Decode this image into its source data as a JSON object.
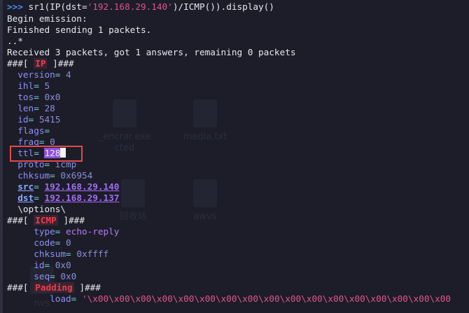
{
  "command": {
    "prompt": ">>>",
    "pre": " sr1(IP(dst=",
    "dst": "'192.168.29.140'",
    "post": ")/ICMP()).display()"
  },
  "output": [
    "Begin emission:",
    "Finished sending 1 packets.",
    "..*",
    "Received 3 packets, got 1 answers, remaining 0 packets"
  ],
  "ip_layer": {
    "header_prefix": "###[ ",
    "name": "IP",
    "header_suffix": " ]###",
    "fields": [
      {
        "name": "version",
        "value": "4"
      },
      {
        "name": "ihl",
        "value": "5"
      },
      {
        "name": "tos",
        "value": "0x0"
      },
      {
        "name": "len",
        "value": "28"
      },
      {
        "name": "id",
        "value": "5415"
      },
      {
        "name": "flags",
        "value": ""
      },
      {
        "name": "frag",
        "value": "0"
      },
      {
        "name": "ttl",
        "value": "128"
      },
      {
        "name": "proto",
        "value": "icmp"
      },
      {
        "name": "chksum",
        "value": "0x6954"
      },
      {
        "name": "src",
        "value": "192.168.29.140"
      },
      {
        "name": "dst",
        "value": "192.168.29.137"
      }
    ],
    "options": "\\options\\"
  },
  "icmp_layer": {
    "header_prefix": "###[ ",
    "name": "ICMP",
    "header_suffix": " ]###",
    "fields": [
      {
        "name": "type",
        "value": "echo-reply"
      },
      {
        "name": "code",
        "value": "0"
      },
      {
        "name": "chksum",
        "value": "0xffff"
      },
      {
        "name": "id",
        "value": "0x0"
      },
      {
        "name": "seq",
        "value": "0x0"
      }
    ]
  },
  "padding_layer": {
    "header_prefix": "###[ ",
    "name": "Padding",
    "header_suffix": " ]###",
    "load_name": "load",
    "load_value": "'\\x00\\x00\\x00\\x00\\x00\\x00\\x00\\x00\\x00\\x00\\x00\\x00\\x00\\x00\\x00\\x00\\x00"
  },
  "equals": "= ",
  "colors": {
    "background": "#1c1d29",
    "prompt": "#4f8cf5",
    "layer_name": "#ef3b4b",
    "field_name": "#8f8ff5",
    "highlight_box": "#e34a4a",
    "selection": "#8a52d8"
  },
  "desktop_ghosts": [
    {
      "label": "_encrar.exe"
    },
    {
      "label": "cted"
    },
    {
      "label": "media.txt"
    },
    {
      "label": "回收站"
    },
    {
      "label": "awvs"
    },
    {
      "label": "nvs"
    }
  ]
}
